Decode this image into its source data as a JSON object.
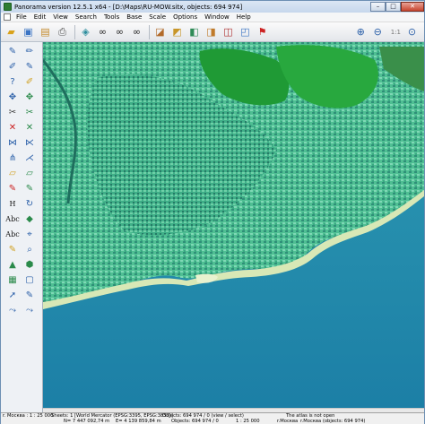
{
  "window": {
    "title": "Panorama version 12.5.1 x64  - [D:\\Maps\\RU-MOW.sitx, objects: 694 974]"
  },
  "menu": [
    "File",
    "Edit",
    "View",
    "Search",
    "Tools",
    "Base",
    "Scale",
    "Options",
    "Window",
    "Help"
  ],
  "toolbar": {
    "zoom_ratio": "1:1",
    "icons": [
      "open-folder-icon",
      "save-icon",
      "map-sheets-icon",
      "print-icon",
      "layers-icon",
      "binoculars-icon",
      "binoculars-search-icon",
      "binoculars-select-icon",
      "select-area-icon",
      "select-object-icon",
      "select-copy-icon",
      "select-transform-icon",
      "select-delete-icon",
      "measure-icon",
      "flag-icon",
      "zoom-in-icon",
      "zoom-out-icon",
      "zoom-reset-icon"
    ]
  },
  "sidebar": {
    "text_buttons": {
      "h": "H",
      "abc": "Abc",
      "abc_alt": "Abc"
    }
  },
  "status": {
    "row1": {
      "scale": "r. Москва : 1 : 25 000",
      "sheets": "Sheets: 1",
      "projection": "[World Mercator (EPSG:3395, EPSG:3857)]",
      "objects": "Objects: 694 974 / 0  (view / select)",
      "atlas": "The atlas is not open"
    },
    "row2": {
      "n_coord": "N= 7 447 092,74 m",
      "e_coord": "E= 4 139 859,84 m",
      "objects": "Objects: 694 974 / 0",
      "scale": "1 : 25 000",
      "map_name": "r.Москва",
      "obj_count": "r.Москва (objects: 694 974)"
    }
  },
  "colors": {
    "accent": "#3b74c4",
    "sea_deep": "#1c7fa6",
    "sea_shallow": "#2f9db4",
    "urban": "#4fbf93",
    "vegetation": "#1f9a35",
    "beach": "#d8e8b6"
  }
}
